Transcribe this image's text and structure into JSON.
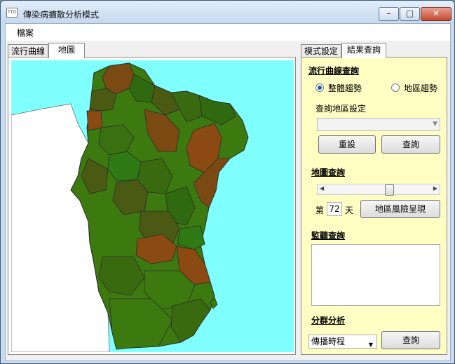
{
  "window": {
    "title": "傳染病擴散分析模式",
    "app_icon_text": "TTO",
    "controls": {
      "minimize": "–",
      "maximize": "□",
      "close": "✕"
    }
  },
  "menu": {
    "file": "檔案"
  },
  "left_tabs": [
    {
      "label": "流行曲線",
      "active": false
    },
    {
      "label": "地圖",
      "active": true
    }
  ],
  "right_tabs": [
    {
      "label": "模式設定",
      "active": false
    },
    {
      "label": "結果查詢",
      "active": true
    }
  ],
  "map": {
    "sea_color": "#80ffff",
    "land_color": "#ffffff",
    "low_risk_color": "#2f7a0f",
    "mid_risk_color": "#4a5a12",
    "high_risk_color": "#8b4a12"
  },
  "panel": {
    "curve_query": {
      "title": "流行曲線查詢",
      "radio_overall": "整體趨勢",
      "radio_region": "地區趨勢",
      "selected": "整體趨勢",
      "region_setting_label": "查詢地區設定",
      "region_value": "",
      "reset_button": "重設",
      "query_button": "查詢"
    },
    "map_query": {
      "title": "地圖查詢",
      "day_prefix": "第",
      "day_value": "72",
      "day_suffix": "天",
      "slider_fraction": 0.62,
      "risk_button": "地區風險呈現"
    },
    "monitor_query": {
      "title": "監聽查詢",
      "content": ""
    },
    "cluster": {
      "title": "分群分析",
      "select_value": "傳播時程",
      "query_button": "查詢"
    }
  }
}
